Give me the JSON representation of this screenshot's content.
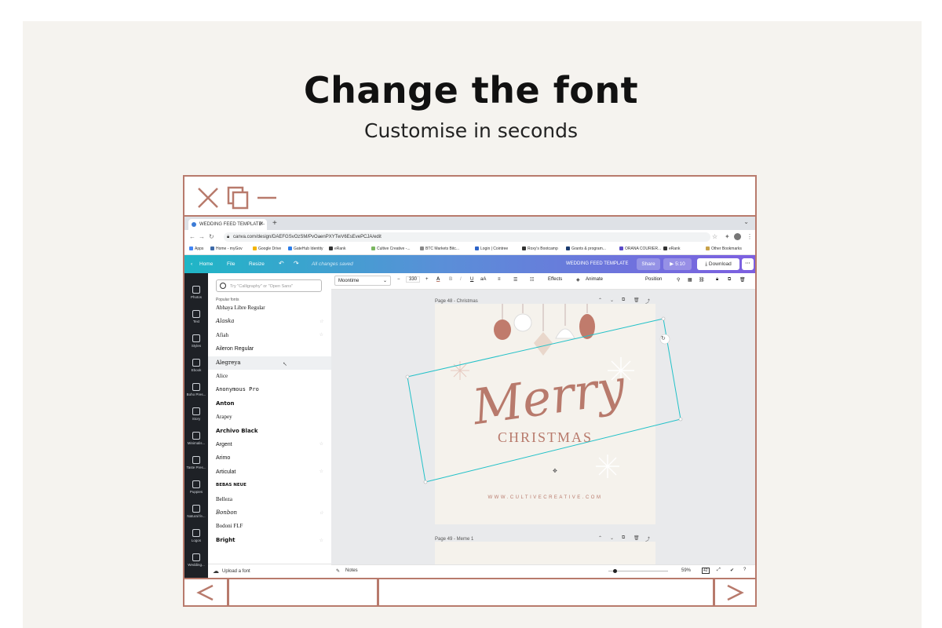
{
  "hero": {
    "title": "Change the font",
    "subtitle": "Customise in seconds"
  },
  "window_icons": [
    "close-x-icon",
    "copy-icon",
    "minimize-icon"
  ],
  "browser": {
    "tab_title": "WEDDING FEED TEMPLATE - ",
    "url": "canva.com/design/DAEFGSvOzSM/PvOaenPXYTwV6EsEvePCJA/edit",
    "bookmarks": [
      "Apps",
      "Home - myGov",
      "Google Drive",
      "GateHub Identity",
      "eRank",
      "Cultive Creative -...",
      "BTC Markets Bitc...",
      "Login | Cointree",
      "Roxy's Bootcamp",
      "Grants & program...",
      "ORANA COURIER...",
      "eRank",
      "Other Bookmarks"
    ]
  },
  "canva_header": {
    "home": "Home",
    "file": "File",
    "resize": "Resize",
    "saved": "All changes saved",
    "doc_title": "WEDDING FEED TEMPLATE",
    "share": "Share",
    "play": "5:10",
    "download": "Download"
  },
  "rail": [
    "Photos",
    "Text",
    "Styles",
    "Ebook",
    "Boho Pres...",
    "Story",
    "Minimalis...",
    "Taste Pres...",
    "Puppies",
    "Natural fe...",
    "Logos",
    "Wedding..."
  ],
  "font_panel": {
    "search_placeholder": "Try \"Calligraphy\" or \"Open Sans\"",
    "section_title": "Popular fonts",
    "fonts": [
      "Abhaya Libre Regular",
      "Alaska",
      "Afiah",
      "Aileron Regular",
      "Alegreya",
      "Alice",
      "Anonymous Pro",
      "Anton",
      "Arapey",
      "Archivo Black",
      "Argent",
      "Arimo",
      "Articulat",
      "BEBAS NEUE",
      "Belleza",
      "Bonbon",
      "Bodoni FLF",
      "Bright"
    ],
    "upload": "Upload a font"
  },
  "toolbar": {
    "font": "Moontime",
    "size": "330",
    "effects": "Effects",
    "animate": "Animate",
    "position": "Position"
  },
  "pages": {
    "page1": "Page 48 - Christmas",
    "page2": "Page 49 - Meme 1"
  },
  "design": {
    "merry": "Merry",
    "christmas": "CHRISTMAS",
    "website": "WWW.CULTIVECREATIVE.COM"
  },
  "status": {
    "notes": "Notes",
    "zoom": "59%",
    "page_num": "42"
  }
}
